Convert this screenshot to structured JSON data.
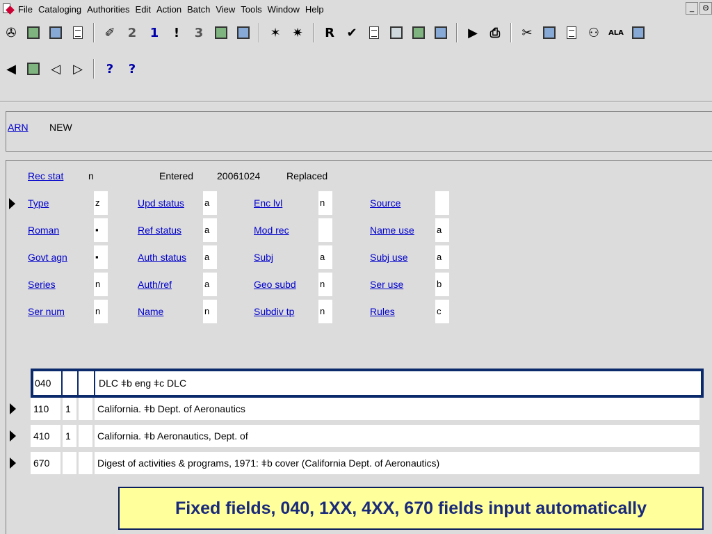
{
  "menu": [
    "File",
    "Cataloging",
    "Authorities",
    "Edit",
    "Action",
    "Batch",
    "View",
    "Tools",
    "Window",
    "Help"
  ],
  "window_controls": {
    "minimize": "_",
    "restore": "Θ"
  },
  "toolbar1": [
    {
      "icon": "connect-icon",
      "glyph": "✇"
    },
    {
      "icon": "save-icon",
      "glyph": ""
    },
    {
      "icon": "workform-icon",
      "glyph": ""
    },
    {
      "icon": "new-record-icon",
      "glyph": ""
    },
    {
      "icon": "validate-icon",
      "glyph": "✐"
    },
    {
      "icon": "two-icon",
      "glyph": "2"
    },
    {
      "icon": "one-icon",
      "glyph": "1"
    },
    {
      "icon": "srs-icon",
      "glyph": "!"
    },
    {
      "icon": "three-icon",
      "glyph": "3"
    },
    {
      "icon": "copy-record-icon",
      "glyph": ""
    },
    {
      "icon": "edit-record-icon",
      "glyph": ""
    },
    {
      "icon": "network-icon",
      "glyph": "✶"
    },
    {
      "icon": "group-icon",
      "glyph": "✷"
    },
    {
      "icon": "replace-icon",
      "glyph": "R"
    },
    {
      "icon": "checkmark-icon",
      "glyph": "✔"
    },
    {
      "icon": "insert-field-icon",
      "glyph": ""
    },
    {
      "icon": "delete-field-icon",
      "glyph": ""
    },
    {
      "icon": "split-icon",
      "glyph": ""
    },
    {
      "icon": "reformat-icon",
      "glyph": ""
    },
    {
      "icon": "submit-icon",
      "glyph": "▶"
    },
    {
      "icon": "print-icon",
      "glyph": "⎙"
    },
    {
      "icon": "cut-icon",
      "glyph": "✂"
    },
    {
      "icon": "copy-icon",
      "glyph": ""
    },
    {
      "icon": "paste-icon",
      "glyph": ""
    },
    {
      "icon": "find-icon",
      "glyph": "⚇"
    },
    {
      "icon": "ala-icon",
      "glyph": "ALA"
    },
    {
      "icon": "diacritics-icon",
      "glyph": ""
    }
  ],
  "toolbar2": [
    {
      "icon": "back-icon",
      "glyph": "◀"
    },
    {
      "icon": "book-icon",
      "glyph": ""
    },
    {
      "icon": "previous-icon",
      "glyph": "◁"
    },
    {
      "icon": "next-icon",
      "glyph": "▷"
    },
    {
      "icon": "help-context-icon",
      "glyph": "?"
    },
    {
      "icon": "help-icon",
      "glyph": "?"
    }
  ],
  "arn": {
    "label": "ARN",
    "value": "NEW"
  },
  "fixed_fields": {
    "rec_stat": {
      "label": "Rec stat",
      "value": "n"
    },
    "entered": {
      "label": "Entered",
      "value": "20061024"
    },
    "replaced": {
      "label": "Replaced"
    },
    "rows": [
      [
        {
          "label": "Type",
          "value": "z"
        },
        {
          "label": "Upd status",
          "value": "a"
        },
        {
          "label": "Enc lvl",
          "value": "n"
        },
        {
          "label": "Source",
          "value": ""
        }
      ],
      [
        {
          "label": "Roman",
          "value": "▪"
        },
        {
          "label": "Ref status",
          "value": "a"
        },
        {
          "label": "Mod rec",
          "value": ""
        },
        {
          "label": "Name use",
          "value": "a"
        }
      ],
      [
        {
          "label": "Govt agn",
          "value": "▪"
        },
        {
          "label": "Auth status",
          "value": "a"
        },
        {
          "label": "Subj",
          "value": "a"
        },
        {
          "label": "Subj use",
          "value": "a"
        }
      ],
      [
        {
          "label": "Series",
          "value": "n"
        },
        {
          "label": "Auth/ref",
          "value": "a"
        },
        {
          "label": "Geo subd",
          "value": "n"
        },
        {
          "label": "Ser use",
          "value": "b"
        }
      ],
      [
        {
          "label": "Ser num",
          "value": "n"
        },
        {
          "label": "Name",
          "value": "n"
        },
        {
          "label": "Subdiv tp",
          "value": "n"
        },
        {
          "label": "Rules",
          "value": "c"
        }
      ]
    ]
  },
  "variable_fields": [
    {
      "tag": "040",
      "ind1": "",
      "ind2": "",
      "text": "DLC ǂb eng ǂc DLC",
      "selected": true
    },
    {
      "tag": "110",
      "ind1": "1",
      "ind2": "",
      "text": "California. ǂb Dept. of Aeronautics"
    },
    {
      "tag": "410",
      "ind1": "1",
      "ind2": "",
      "text": "California. ǂb Aeronautics, Dept. of"
    },
    {
      "tag": "670",
      "ind1": "",
      "ind2": "",
      "text": "Digest of activities & programs, 1971: ǂb cover (California Dept. of Aeronautics)"
    }
  ],
  "callout": "Fixed fields, 040, 1XX, 4XX, 670 fields input automatically"
}
